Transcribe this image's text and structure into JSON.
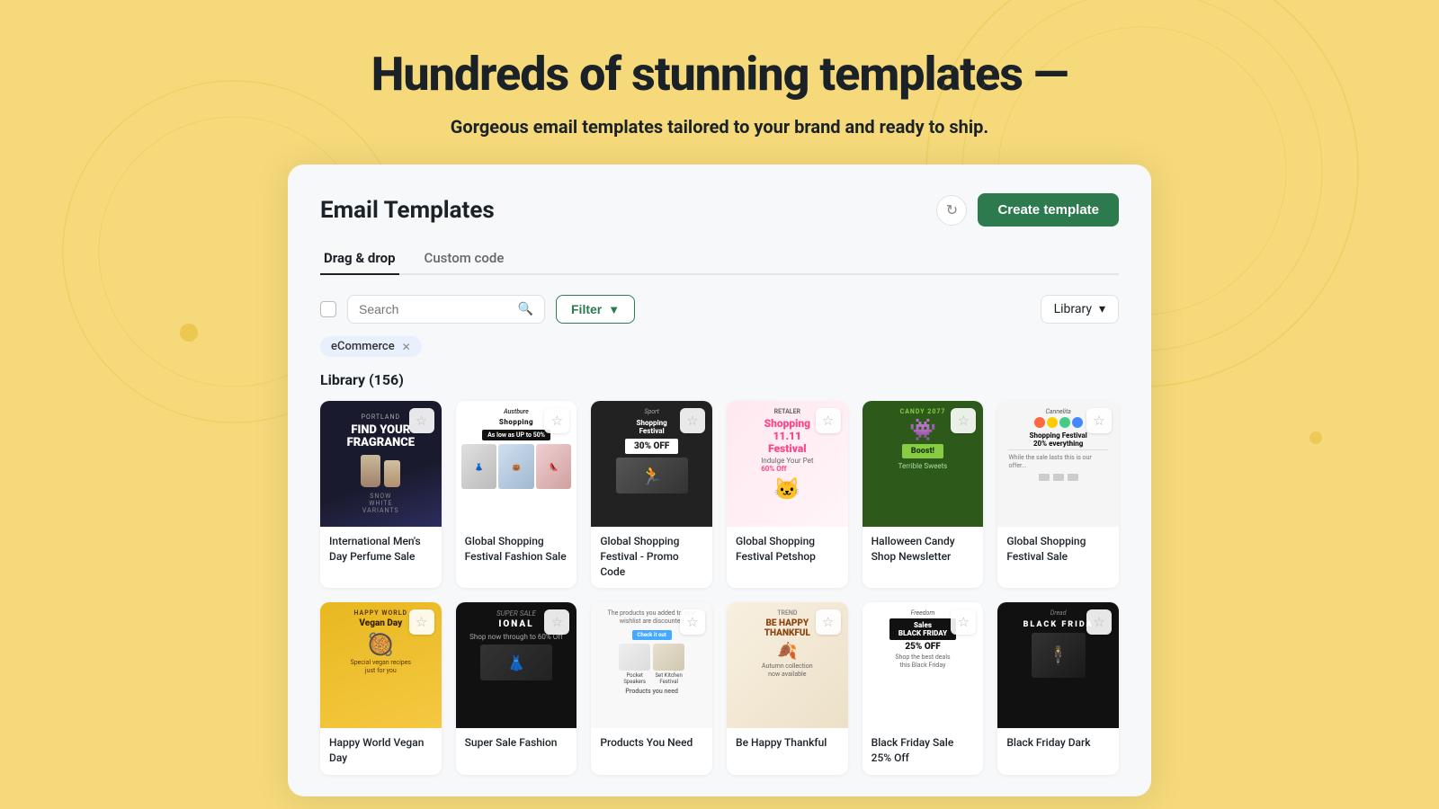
{
  "hero": {
    "title": "Hundreds of stunning templates —",
    "subtitle": "Gorgeous email templates tailored to your brand and ready to ship."
  },
  "page": {
    "card_title": "Email Templates",
    "refresh_label": "↻",
    "create_button_label": "Create template"
  },
  "tabs": [
    {
      "id": "drag-drop",
      "label": "Drag & drop",
      "active": true
    },
    {
      "id": "custom-code",
      "label": "Custom code",
      "active": false
    }
  ],
  "toolbar": {
    "search_placeholder": "Search",
    "filter_label": "Filter",
    "library_label": "Library",
    "chevron": "▾"
  },
  "tags": [
    {
      "label": "eCommerce",
      "removable": true
    }
  ],
  "section": {
    "title": "Library (156)"
  },
  "templates_row1": [
    {
      "id": "t1",
      "name": "International Men's Day Perfume Sale",
      "theme": "dark-perfume",
      "color": "#1a1a2e"
    },
    {
      "id": "t2",
      "name": "Global Shopping Festival Fashion Sale",
      "theme": "fashion-sale",
      "color": "#fff"
    },
    {
      "id": "t3",
      "name": "Global Shopping Festival - Promo Code",
      "theme": "promo-dark",
      "color": "#222"
    },
    {
      "id": "t4",
      "name": "Global Shopping Festival Petshop",
      "theme": "petshop-pink",
      "color": "#ffe8f0"
    },
    {
      "id": "t5",
      "name": "Halloween Candy Shop Newsletter",
      "theme": "halloween-green",
      "color": "#2d5a1b"
    },
    {
      "id": "t6",
      "name": "Global Shopping Festival Sale",
      "theme": "white-promo",
      "color": "#f5f5f5"
    }
  ],
  "templates_row2": [
    {
      "id": "t7",
      "name": "Happy World Vegan Day",
      "theme": "vegan-yellow",
      "color": "#f5c842"
    },
    {
      "id": "t8",
      "name": "Super Sale Fashion",
      "theme": "fashion-dark",
      "color": "#111"
    },
    {
      "id": "t9",
      "name": "Products You Need",
      "theme": "product-light",
      "color": "#f5f5f5"
    },
    {
      "id": "t10",
      "name": "Be Happy Thankful",
      "theme": "thankful-warm",
      "color": "#f8f3ee"
    },
    {
      "id": "t11",
      "name": "Black Friday Sale 25% Off",
      "theme": "black-friday",
      "color": "#fff"
    },
    {
      "id": "t12",
      "name": "Black Friday Dark",
      "theme": "black-friday-dark",
      "color": "#111"
    }
  ]
}
